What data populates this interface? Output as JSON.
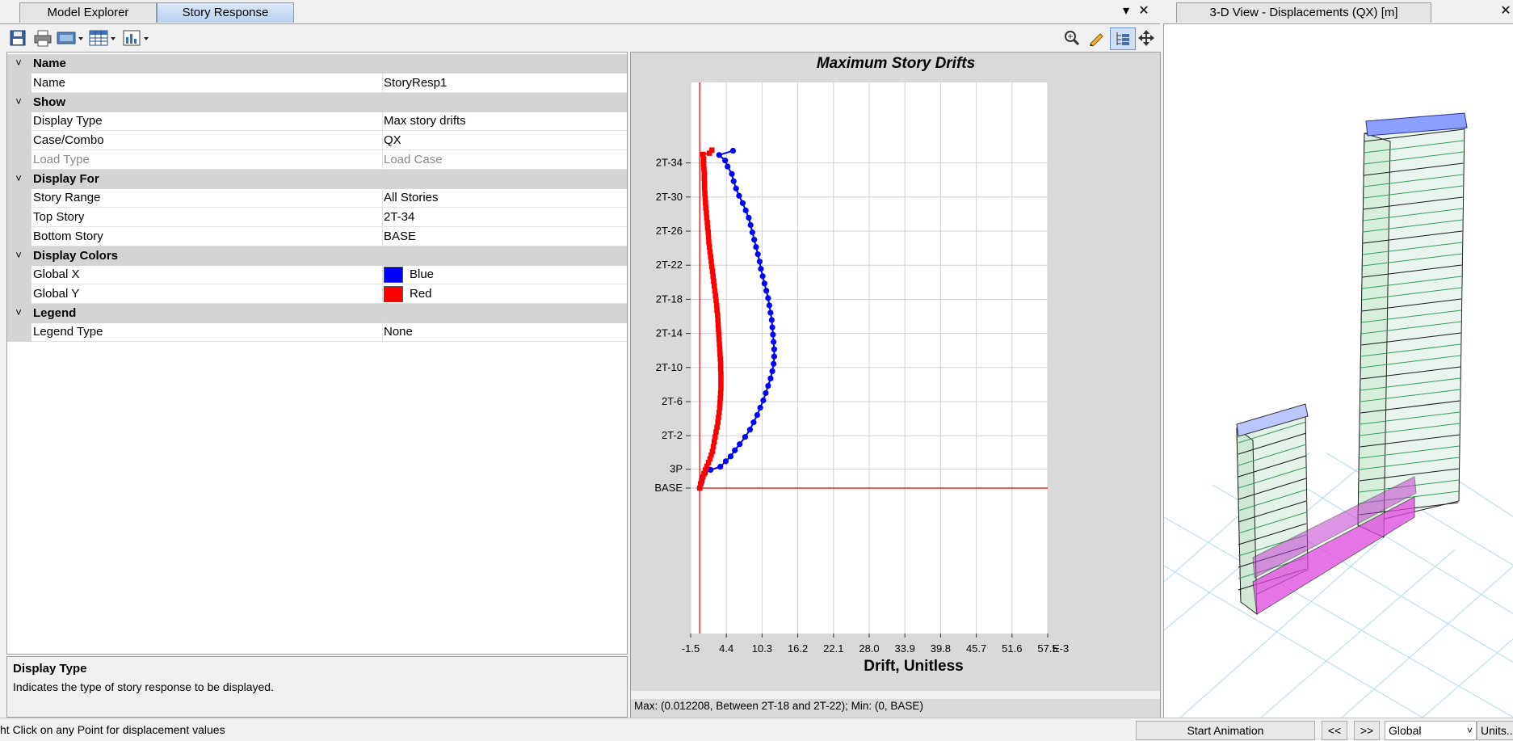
{
  "left_window": {
    "tabs": [
      {
        "label": "Model Explorer"
      },
      {
        "label": "Story Response",
        "active": true
      }
    ],
    "controls": {
      "pin": "▾",
      "close": "✕"
    },
    "toolbar": {
      "left_icons": [
        "save-icon",
        "print-icon",
        "display-options-icon",
        "table-icon",
        "chart-options-icon"
      ],
      "right_icons": [
        "zoom-icon",
        "pencil-icon",
        "tree-icon",
        "pan-icon"
      ]
    }
  },
  "property_grid": {
    "categories": [
      {
        "label": "Name",
        "rows": [
          {
            "name": "Name",
            "value": "StoryResp1"
          }
        ]
      },
      {
        "label": "Show",
        "rows": [
          {
            "name": "Display Type",
            "value": "Max story drifts"
          },
          {
            "name": "Case/Combo",
            "value": "QX"
          },
          {
            "name": "Load Type",
            "value": "Load Case",
            "disabled": true
          }
        ]
      },
      {
        "label": "Display For",
        "rows": [
          {
            "name": "Story Range",
            "value": "All Stories"
          },
          {
            "name": "Top Story",
            "value": "2T-34"
          },
          {
            "name": "Bottom Story",
            "value": "BASE"
          }
        ]
      },
      {
        "label": "Display Colors",
        "rows": [
          {
            "name": "Global X",
            "value": "Blue",
            "swatch": "#0000ff"
          },
          {
            "name": "Global Y",
            "value": "Red",
            "swatch": "#ff0000"
          }
        ]
      },
      {
        "label": "Legend",
        "rows": [
          {
            "name": "Legend Type",
            "value": "None"
          }
        ]
      }
    ]
  },
  "description": {
    "title": "Display Type",
    "text": "Indicates the type of story response to be displayed."
  },
  "chart_data": {
    "type": "line",
    "title": "Maximum Story Drifts",
    "xlabel": "Drift, Unitless",
    "x_unit_suffix": "E-3",
    "x_ticks": [
      "-1.5",
      "4.4",
      "10.3",
      "16.2",
      "22.1",
      "28.0",
      "33.9",
      "39.8",
      "45.7",
      "51.6",
      "57.5"
    ],
    "xlim": [
      -1.5,
      57.5
    ],
    "y_ticks": [
      "BASE",
      "3P",
      "2T-2",
      "2T-6",
      "2T-10",
      "2T-14",
      "2T-18",
      "2T-22",
      "2T-26",
      "2T-30",
      "2T-34"
    ],
    "grid": true,
    "series": [
      {
        "name": "Global X",
        "color": "#0000ff",
        "marker": "circle",
        "points": [
          [
            0,
            0.0
          ],
          [
            0.2,
            0.35
          ],
          [
            0.35,
            0.55
          ],
          [
            0.5,
            0.9
          ],
          [
            0.85,
            1.2
          ],
          [
            1.8,
            1.5
          ],
          [
            3.4,
            1.75
          ],
          [
            4.3,
            2.2
          ],
          [
            5.1,
            2.6
          ],
          [
            5.8,
            3.1
          ],
          [
            6.6,
            3.6
          ],
          [
            7.5,
            4.2
          ],
          [
            8.3,
            4.8
          ],
          [
            8.9,
            5.4
          ],
          [
            9.5,
            6.0
          ],
          [
            10.0,
            6.6
          ],
          [
            10.5,
            7.2
          ],
          [
            10.9,
            7.8
          ],
          [
            11.3,
            8.4
          ],
          [
            11.7,
            9.0
          ],
          [
            12.0,
            9.6
          ],
          [
            12.2,
            10.2
          ],
          [
            12.3,
            10.8
          ],
          [
            12.3,
            11.4
          ],
          [
            12.2,
            12.0
          ],
          [
            12.1,
            12.6
          ],
          [
            12.0,
            13.2
          ],
          [
            11.9,
            13.8
          ],
          [
            11.7,
            14.4
          ],
          [
            11.5,
            15.0
          ],
          [
            11.3,
            15.6
          ],
          [
            11.0,
            16.2
          ],
          [
            10.7,
            16.8
          ],
          [
            10.4,
            17.4
          ],
          [
            10.1,
            18.0
          ],
          [
            9.9,
            18.6
          ],
          [
            9.6,
            19.2
          ],
          [
            9.3,
            19.8
          ],
          [
            9.0,
            20.4
          ],
          [
            8.7,
            21.0
          ],
          [
            8.4,
            21.6
          ],
          [
            8.1,
            22.2
          ],
          [
            7.6,
            22.8
          ],
          [
            7.1,
            23.4
          ],
          [
            6.5,
            24.0
          ],
          [
            6.0,
            24.6
          ],
          [
            5.6,
            25.2
          ],
          [
            5.3,
            25.8
          ],
          [
            4.6,
            26.4
          ],
          [
            4.2,
            26.9
          ],
          [
            3.2,
            27.35
          ],
          [
            5.5,
            27.7
          ]
        ]
      },
      {
        "name": "Global Y",
        "color": "#ff0000",
        "marker": "square",
        "points": [
          [
            0,
            0.0
          ],
          [
            0.15,
            0.35
          ],
          [
            0.3,
            0.6
          ],
          [
            0.5,
            0.9
          ],
          [
            0.7,
            1.2
          ],
          [
            0.95,
            1.5
          ],
          [
            1.2,
            1.8
          ],
          [
            1.45,
            2.1
          ],
          [
            1.7,
            2.4
          ],
          [
            1.9,
            2.7
          ],
          [
            2.1,
            3.0
          ],
          [
            2.25,
            3.4
          ],
          [
            2.4,
            3.8
          ],
          [
            2.55,
            4.2
          ],
          [
            2.7,
            4.6
          ],
          [
            2.85,
            5.0
          ],
          [
            3.0,
            5.4
          ],
          [
            3.1,
            5.8
          ],
          [
            3.2,
            6.2
          ],
          [
            3.3,
            6.6
          ],
          [
            3.35,
            7.0
          ],
          [
            3.4,
            7.4
          ],
          [
            3.45,
            7.8
          ],
          [
            3.5,
            8.2
          ],
          [
            3.5,
            8.6
          ],
          [
            3.5,
            9.0
          ],
          [
            3.5,
            9.4
          ],
          [
            3.45,
            9.8
          ],
          [
            3.45,
            10.2
          ],
          [
            3.4,
            10.6
          ],
          [
            3.35,
            11.0
          ],
          [
            3.3,
            11.4
          ],
          [
            3.25,
            11.8
          ],
          [
            3.2,
            12.2
          ],
          [
            3.15,
            12.6
          ],
          [
            3.1,
            13.0
          ],
          [
            3.05,
            13.4
          ],
          [
            3.0,
            13.8
          ],
          [
            2.95,
            14.2
          ],
          [
            2.85,
            14.6
          ],
          [
            2.8,
            15.0
          ],
          [
            2.7,
            15.4
          ],
          [
            2.6,
            15.8
          ],
          [
            2.5,
            16.2
          ],
          [
            2.4,
            16.6
          ],
          [
            2.3,
            17.0
          ],
          [
            2.2,
            17.4
          ],
          [
            2.1,
            17.8
          ],
          [
            2.0,
            18.2
          ],
          [
            1.9,
            18.6
          ],
          [
            1.8,
            19.0
          ],
          [
            1.7,
            19.4
          ],
          [
            1.6,
            19.8
          ],
          [
            1.5,
            20.2
          ],
          [
            1.45,
            20.6
          ],
          [
            1.4,
            21.0
          ],
          [
            1.3,
            21.4
          ],
          [
            1.25,
            21.8
          ],
          [
            1.15,
            22.2
          ],
          [
            1.1,
            22.6
          ],
          [
            1.0,
            23.0
          ],
          [
            0.95,
            23.4
          ],
          [
            0.9,
            23.8
          ],
          [
            0.85,
            24.2
          ],
          [
            0.8,
            24.6
          ],
          [
            0.8,
            25.0
          ],
          [
            0.75,
            25.4
          ],
          [
            0.75,
            25.8
          ],
          [
            0.7,
            26.2
          ],
          [
            0.65,
            26.6
          ],
          [
            0.65,
            27.0
          ],
          [
            0.55,
            27.4
          ],
          [
            1.6,
            27.5
          ],
          [
            2.0,
            27.75
          ]
        ]
      }
    ],
    "status": "Max: (0.012208, Between 2T-18 and 2T-22);   Min: (0, BASE)"
  },
  "right_window": {
    "tab_label": "3-D View  - Displacements (QX)  [m]",
    "close": "✕"
  },
  "statusbar": {
    "hint": "ht Click on any Point for displacement values",
    "start_animation": "Start Animation",
    "prev": "<<",
    "next": ">>",
    "coord_system": "Global",
    "units": "Units..."
  }
}
